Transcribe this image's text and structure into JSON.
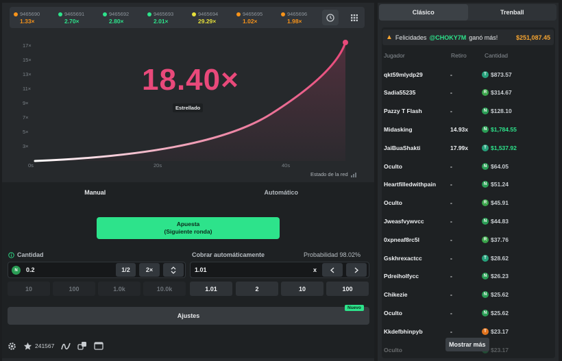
{
  "history": [
    {
      "id": "9465690",
      "mult": "1.33×",
      "color": "#f7931a"
    },
    {
      "id": "9465691",
      "mult": "2.70×",
      "color": "#2de38b"
    },
    {
      "id": "9465692",
      "mult": "2.80×",
      "color": "#2de38b"
    },
    {
      "id": "9465693",
      "mult": "2.01×",
      "color": "#2de38b"
    },
    {
      "id": "9465694",
      "mult": "29.29×",
      "color": "#e6e03b"
    },
    {
      "id": "9465695",
      "mult": "1.02×",
      "color": "#f7931a"
    },
    {
      "id": "9465696",
      "mult": "1.98×",
      "color": "#f7931a"
    }
  ],
  "game": {
    "multiplier": "18.40×",
    "status": "Estrellado",
    "network_state": "Estado de la red",
    "y_ticks": [
      "17×",
      "15×",
      "13×",
      "11×",
      "9×",
      "7×",
      "5×",
      "3×"
    ],
    "x_ticks": [
      "0s",
      "20s",
      "40s"
    ]
  },
  "controls": {
    "tab_manual": "Manual",
    "tab_auto": "Automático",
    "bet_label": "Apuesta",
    "bet_sub": "(Siguiente ronda)",
    "amount_label": "Cantidad",
    "amount_value": "0.2",
    "half": "1/2",
    "double": "2×",
    "cashout_label": "Cobrar automáticamente",
    "probability": "Probabilidad 98.02%",
    "cashout_value": "1.01",
    "cashout_unit": "x",
    "amount_quick": [
      "10",
      "100",
      "1.0k",
      "10.0k"
    ],
    "cashout_quick": [
      "1.01",
      "2",
      "10",
      "100"
    ],
    "settings": "Ajustes",
    "new_badge": "Nuevo",
    "players_count": "241567"
  },
  "right": {
    "tab_classic": "Clásico",
    "tab_trenball": "Trenball",
    "congrats_text": "Felicidades",
    "congrats_user": "@CHOKY7M",
    "congrats_won": "ganó más!",
    "congrats_amount": "$251,087.45",
    "col_player": "Jugador",
    "col_cashout": "Retiro",
    "col_amount": "Cantidad",
    "show_more": "Mostrar más",
    "players": [
      {
        "name": "qkt59mlydp29",
        "ret": "-",
        "amount": "$873.57",
        "coin": "#26a17b",
        "sym": "T",
        "win": false
      },
      {
        "name": "Sadia55235",
        "ret": "-",
        "amount": "$314.67",
        "coin": "#3aa34a",
        "sym": "R",
        "win": false
      },
      {
        "name": "Pazzy T Flash",
        "ret": "-",
        "amount": "$128.10",
        "coin": "#2a9d55",
        "sym": "N",
        "win": false
      },
      {
        "name": "Midasking",
        "ret": "14.93x",
        "amount": "$1,784.55",
        "coin": "#2a9d55",
        "sym": "N",
        "win": true
      },
      {
        "name": "JaiBuaShakti",
        "ret": "17.99x",
        "amount": "$1,537.92",
        "coin": "#26a17b",
        "sym": "T",
        "win": true
      },
      {
        "name": "Oculto",
        "ret": "-",
        "amount": "$64.05",
        "coin": "#2a9d55",
        "sym": "N",
        "win": false
      },
      {
        "name": "Heartfilledwithpain",
        "ret": "-",
        "amount": "$51.24",
        "coin": "#2a9d55",
        "sym": "N",
        "win": false
      },
      {
        "name": "Oculto",
        "ret": "-",
        "amount": "$45.91",
        "coin": "#3aa34a",
        "sym": "R",
        "win": false
      },
      {
        "name": "Jweasfvywvcc",
        "ret": "-",
        "amount": "$44.83",
        "coin": "#2a9d55",
        "sym": "N",
        "win": false
      },
      {
        "name": "0xpneaf8rc5l",
        "ret": "-",
        "amount": "$37.76",
        "coin": "#3aa34a",
        "sym": "R",
        "win": false
      },
      {
        "name": "Gskhrexactcc",
        "ret": "-",
        "amount": "$28.62",
        "coin": "#26a17b",
        "sym": "T",
        "win": false
      },
      {
        "name": "Pdreiholfycc",
        "ret": "-",
        "amount": "$26.23",
        "coin": "#2a9d55",
        "sym": "N",
        "win": false
      },
      {
        "name": "Chikezie",
        "ret": "-",
        "amount": "$25.62",
        "coin": "#2a9d55",
        "sym": "N",
        "win": false
      },
      {
        "name": "Oculto",
        "ret": "-",
        "amount": "$25.62",
        "coin": "#2a9d55",
        "sym": "N",
        "win": false
      },
      {
        "name": "Kkdefbhinpyb",
        "ret": "-",
        "amount": "$23.17",
        "coin": "#e0731d",
        "sym": "T",
        "win": false
      },
      {
        "name": "Oculto",
        "ret": "-",
        "amount": "$23.17",
        "coin": "#2a9d55",
        "sym": "N",
        "win": false
      }
    ]
  }
}
